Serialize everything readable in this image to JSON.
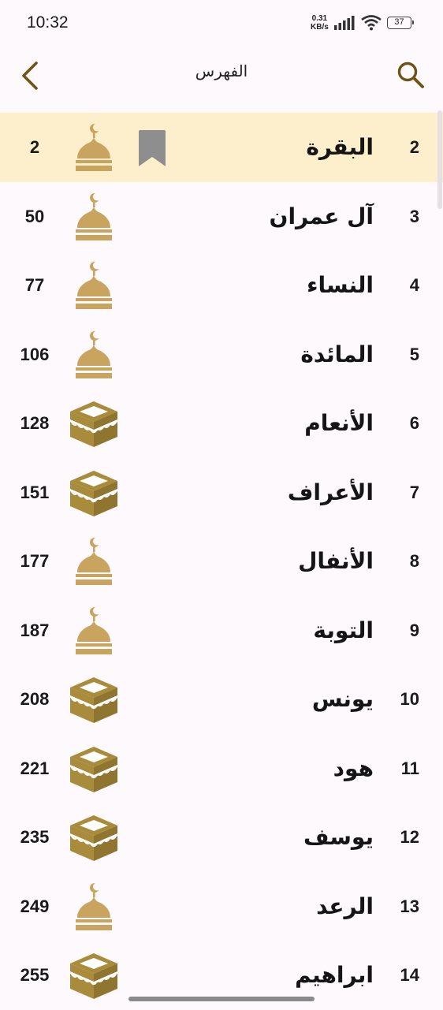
{
  "status_bar": {
    "time": "10:32",
    "net_speed_value": "0.31",
    "net_speed_unit": "KB/s",
    "battery": "37"
  },
  "app_bar": {
    "title": "الفهرس",
    "back_icon": "chevron-left-icon",
    "search_icon": "search-icon"
  },
  "colors": {
    "accent_gold": "#C8A45F",
    "kaaba_gold": "#A88C3C",
    "highlight": "#FDEFCB",
    "bookmark_gray": "#8E8E8E",
    "background": "#FDF9FC"
  },
  "surahs": [
    {
      "number": "2",
      "name": "البقرة",
      "type": "mosque-icon",
      "page": "2",
      "highlighted": true,
      "bookmarked": true
    },
    {
      "number": "3",
      "name": "آل عمران",
      "type": "mosque-icon",
      "page": "50"
    },
    {
      "number": "4",
      "name": "النساء",
      "type": "mosque-icon",
      "page": "77"
    },
    {
      "number": "5",
      "name": "المائدة",
      "type": "mosque-icon",
      "page": "106"
    },
    {
      "number": "6",
      "name": "الأنعام",
      "type": "kaaba-icon",
      "page": "128"
    },
    {
      "number": "7",
      "name": "الأعراف",
      "type": "kaaba-icon",
      "page": "151"
    },
    {
      "number": "8",
      "name": "الأنفال",
      "type": "mosque-icon",
      "page": "177"
    },
    {
      "number": "9",
      "name": "التوبة",
      "type": "mosque-icon",
      "page": "187"
    },
    {
      "number": "10",
      "name": "يونس",
      "type": "kaaba-icon",
      "page": "208"
    },
    {
      "number": "11",
      "name": "هود",
      "type": "kaaba-icon",
      "page": "221"
    },
    {
      "number": "12",
      "name": "يوسف",
      "type": "kaaba-icon",
      "page": "235"
    },
    {
      "number": "13",
      "name": "الرعد",
      "type": "mosque-icon",
      "page": "249"
    },
    {
      "number": "14",
      "name": "ابراهيم",
      "type": "kaaba-icon",
      "page": "255"
    }
  ]
}
